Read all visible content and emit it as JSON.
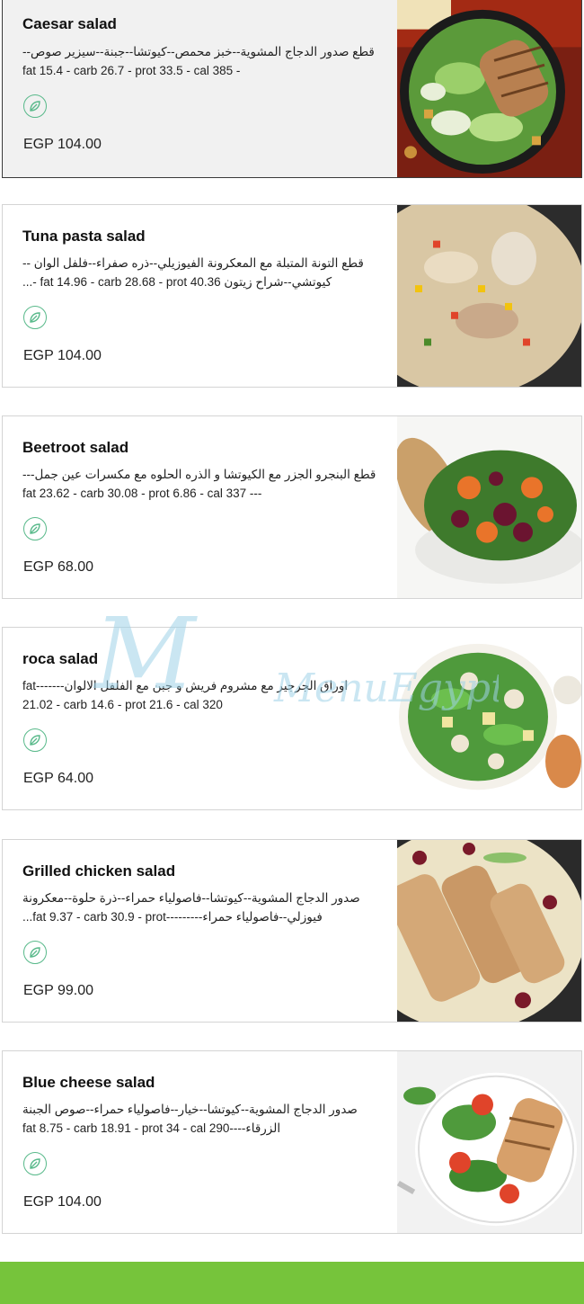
{
  "watermark": "MenuEgypt.com",
  "items": [
    {
      "title": "Caesar salad",
      "desc": "قطع صدور الدجاج المشوية--خبز محمص--كيوتشا--جبنة--سيزير صوص--- fat 15.4 - carb 26.7 - prot 33.5 - cal 385",
      "price": "EGP 104.00",
      "icon": "leaf-icon"
    },
    {
      "title": "Tuna pasta salad",
      "desc": "قطع التونة المتبلة مع المعكرونة الفيوزيلي--ذره صفراء--فلفل الوان -- كيوتشي--شراح زيتون fat 14.96 - carb 28.68 - prot 40.36 -...",
      "price": "EGP 104.00",
      "icon": "leaf-icon"
    },
    {
      "title": "Beetroot salad",
      "desc": "قطع البنجرو الجزر مع الكيوتشا و الذره الحلوه مع مكسرات عين جمل------ fat 23.62 - carb 30.08 - prot 6.86 - cal 337",
      "price": "EGP 68.00",
      "icon": "leaf-icon"
    },
    {
      "title": "roca salad",
      "desc": "اوراق الجرجير مع مشروم فريش و جبن مع الفلفل الالوان-------fat 21.02 - carb 14.6 - prot 21.6 - cal 320",
      "price": "EGP 64.00",
      "icon": "leaf-icon"
    },
    {
      "title": "Grilled chicken salad",
      "desc": "صدور الدجاج المشوية--كيوتشا--فاصولياء حمراء--ذرة حلوة--معكرونة فيوزلي--فاصولياء حمراء---------fat 9.37 - carb 30.9 - prot...",
      "price": "EGP 99.00",
      "icon": "leaf-icon"
    },
    {
      "title": "Blue cheese salad",
      "desc": "صدور الدجاج المشوية--كيوتشا--خيار--فاصولياء حمراء--صوص الجبنة الزرقاء----fat 8.75 - carb 18.91 - prot 34 - cal 290",
      "price": "EGP 104.00",
      "icon": "leaf-icon"
    }
  ],
  "colors": {
    "accent_green": "#76c43b",
    "leaf_icon": "#58b98a",
    "watermark": "#9fd3e8"
  }
}
